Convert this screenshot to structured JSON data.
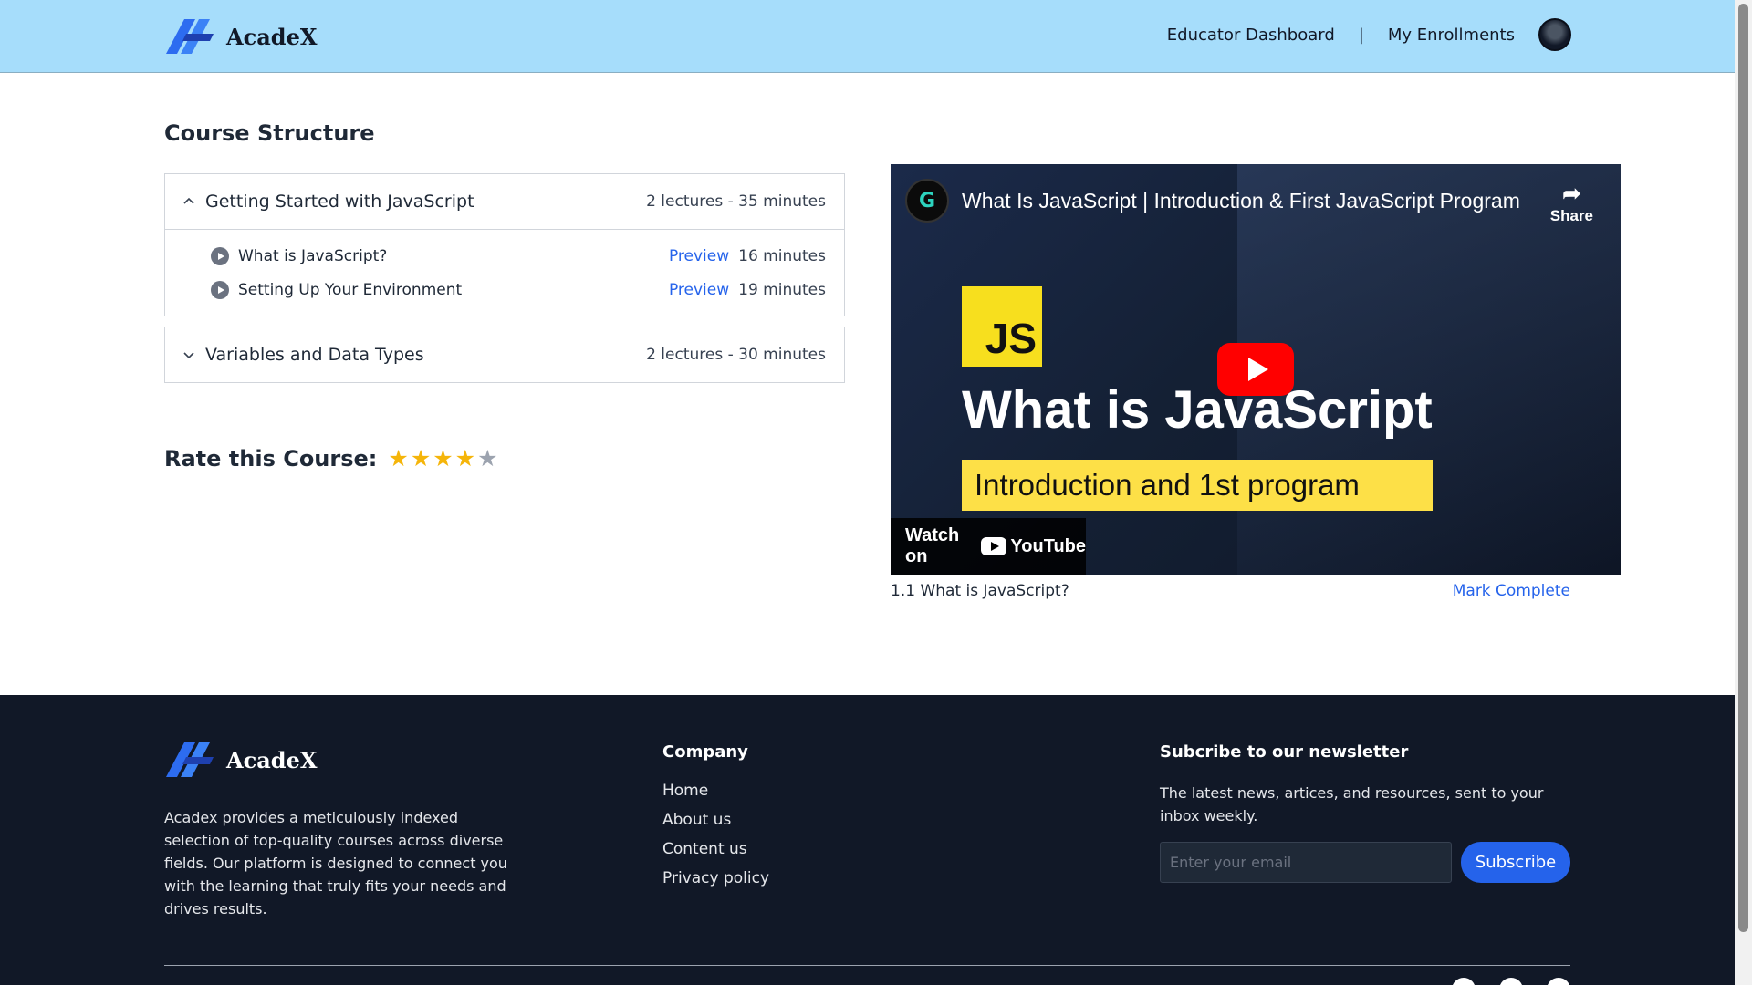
{
  "header": {
    "brand": "AcadeX",
    "nav": {
      "educator": "Educator Dashboard",
      "separator": "|",
      "enrollments": "My Enrollments"
    }
  },
  "course": {
    "title": "Course Structure",
    "chapters": [
      {
        "title": "Getting Started with JavaScript",
        "meta": "2 lectures - 35 minutes",
        "expanded": true,
        "lectures": [
          {
            "title": "What is JavaScript?",
            "preview": "Preview",
            "duration": "16 minutes"
          },
          {
            "title": "Setting Up Your Environment",
            "preview": "Preview",
            "duration": "19 minutes"
          }
        ]
      },
      {
        "title": "Variables and Data Types",
        "meta": "2 lectures - 30 minutes",
        "expanded": false
      }
    ],
    "rating": {
      "label": "Rate this Course:",
      "value": 4,
      "max": 5,
      "active_color": "#f5b50a",
      "inactive_color": "#9ca3af"
    }
  },
  "video": {
    "title": "What Is JavaScript | Introduction & First JavaScript Program",
    "share": "Share",
    "badge": "JS",
    "headline": "What is JavaScript",
    "subheadline": "Introduction and 1st program",
    "watch_on": "Watch on",
    "youtube": "YouTube",
    "caption": "1.1 What is JavaScript?",
    "mark_complete": "Mark Complete"
  },
  "footer": {
    "brand": "AcadeX",
    "about": "Acadex provides a meticulously indexed selection of top-quality courses across diverse fields. Our platform is designed to connect you with the learning that truly fits your needs and drives results.",
    "company": {
      "heading": "Company",
      "links": [
        "Home",
        "About us",
        "Content us",
        "Privacy policy"
      ]
    },
    "newsletter": {
      "heading": "Subcribe to our newsletter",
      "text": "The latest news, artices, and resources, sent to your inbox weekly.",
      "placeholder": "Enter your email",
      "button": "Subscribe"
    }
  },
  "colors": {
    "header_bg": "#a6ddfb",
    "accent": "#2563eb",
    "footer_bg": "#111827"
  }
}
